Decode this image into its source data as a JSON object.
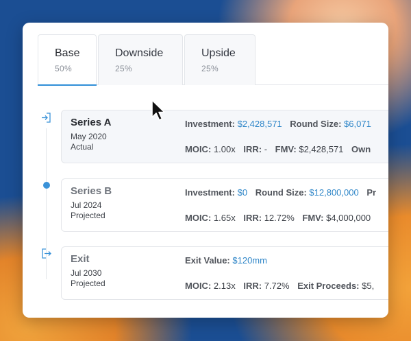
{
  "tabs": [
    {
      "label": "Base",
      "pct": "50%"
    },
    {
      "label": "Downside",
      "pct": "25%"
    },
    {
      "label": "Upside",
      "pct": "25%"
    }
  ],
  "active_tab": "Base",
  "timeline": [
    {
      "icon": "enter-icon",
      "title": "Series A",
      "date": "May 2020",
      "status": "Actual",
      "line1": [
        {
          "label": "Investment:",
          "value": "$2,428,571"
        },
        {
          "label": "Round Size:",
          "value": "$6,071"
        }
      ],
      "line2": [
        {
          "label": "MOIC:",
          "value": "1.00x"
        },
        {
          "label": "IRR:",
          "value": "-"
        },
        {
          "label": "FMV:",
          "value": "$2,428,571"
        },
        {
          "label": "Own",
          "value": ""
        }
      ]
    },
    {
      "icon": "dot-marker",
      "title": "Series B",
      "date": "Jul 2024",
      "status": "Projected",
      "line1": [
        {
          "label": "Investment:",
          "value": "$0"
        },
        {
          "label": "Round Size:",
          "value": "$12,800,000"
        },
        {
          "label": "Pr",
          "value": ""
        }
      ],
      "line2": [
        {
          "label": "MOIC:",
          "value": "1.65x"
        },
        {
          "label": "IRR:",
          "value": "12.72%"
        },
        {
          "label": "FMV:",
          "value": "$4,000,000"
        }
      ]
    },
    {
      "icon": "exit-icon",
      "title": "Exit",
      "date": "Jul 2030",
      "status": "Projected",
      "line1": [
        {
          "label": "Exit Value:",
          "value": "$120mm"
        }
      ],
      "line2": [
        {
          "label": "MOIC:",
          "value": "2.13x"
        },
        {
          "label": "IRR:",
          "value": "7.72%"
        },
        {
          "label": "Exit Proceeds:",
          "value": "$5,"
        }
      ]
    }
  ],
  "colors": {
    "accent": "#2f8ed8",
    "value_blue": "#2f86c8"
  }
}
